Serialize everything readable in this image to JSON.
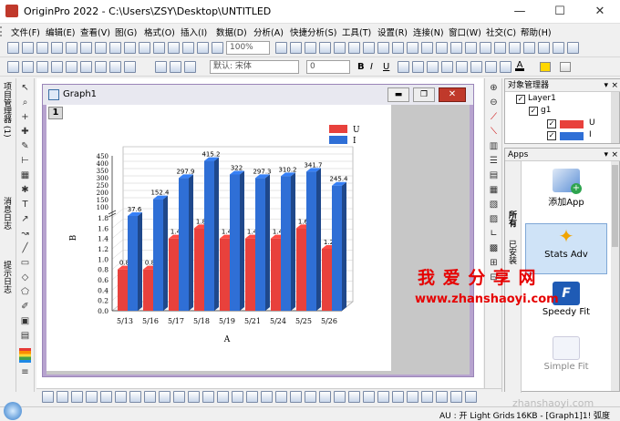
{
  "window": {
    "title": "OriginPro 2022 - C:\\Users\\ZSY\\Desktop\\UNTITLED",
    "minimize": "—",
    "maximize": "☐",
    "close": "✕"
  },
  "menu": [
    "文件(F)",
    "编辑(E)",
    "查看(V)",
    "图(G)",
    "格式(O)",
    "插入(I)",
    "数据(D)",
    "分析(A)",
    "快捷分析(S)",
    "工具(T)",
    "设置(R)",
    "连接(N)",
    "窗口(W)",
    "社交(C)",
    "帮助(H)"
  ],
  "toolbar": {
    "zoom": "100%",
    "font": "默认: 宋体",
    "font_size": "0",
    "bold": "B",
    "italic": "I",
    "underline": "U"
  },
  "left_dock_tabs": [
    "项目管理器 (1)",
    "消息日志",
    "提示日志"
  ],
  "graph_window": {
    "title": "Graph1",
    "layer": "1"
  },
  "object_manager": {
    "title": "对象管理器",
    "layer": "Layer1",
    "group": "g1",
    "items": [
      {
        "label": "U",
        "color": "#e8413c"
      },
      {
        "label": "I",
        "color": "#2f6fd6"
      }
    ]
  },
  "apps": {
    "title": "Apps",
    "tabs": [
      "所有",
      "已安装"
    ],
    "items": [
      {
        "label": "添加App"
      },
      {
        "label": "Stats Adv"
      },
      {
        "label": "Speedy Fit"
      },
      {
        "label": "Simple Fit"
      }
    ]
  },
  "statusbar": {
    "left": "AU : 开 Light Grids",
    "middle": "16KB - [Graph1]1! 弧度"
  },
  "watermark": {
    "line1": "我 爱 分 享 网",
    "line2": "www.zhanshaoyi.com",
    "corner": "zhanshaoyi.com"
  },
  "chart_data": {
    "type": "bar",
    "categories": [
      "5/13",
      "5/16",
      "5/17",
      "5/18",
      "5/19",
      "5/21",
      "5/24",
      "5/25",
      "5/26"
    ],
    "series": [
      {
        "name": "U",
        "color": "#e8413c",
        "values": [
          0.8,
          0.8,
          1.4,
          1.6,
          1.4,
          1.4,
          1.4,
          1.6,
          1.2
        ],
        "labels": [
          "0.8",
          "0.8",
          "1.4",
          "1.8",
          "1.4",
          "1.4",
          "1.4",
          "1.6",
          "1.2"
        ]
      },
      {
        "name": "I",
        "color": "#2f6fd6",
        "values": [
          37.6,
          152.4,
          297.9,
          415.2,
          322,
          297.3,
          310.2,
          341.7,
          245.4
        ],
        "labels": [
          "37.6",
          "152.4",
          "297.9",
          "415.2",
          "322",
          "297.3",
          "310.2",
          "341.7",
          "245.4"
        ]
      }
    ],
    "xlabel": "A",
    "ylabel": "B",
    "y_ticks_lower": [
      "0.0",
      "0.2",
      "0.4",
      "0.6",
      "0.8",
      "1.0",
      "1.2",
      "1.4",
      "1.6",
      "1.8"
    ],
    "y_ticks_upper": [
      "100",
      "150",
      "200",
      "250",
      "300",
      "350",
      "400",
      "450"
    ],
    "axis_break": true,
    "legend": "top-right"
  }
}
